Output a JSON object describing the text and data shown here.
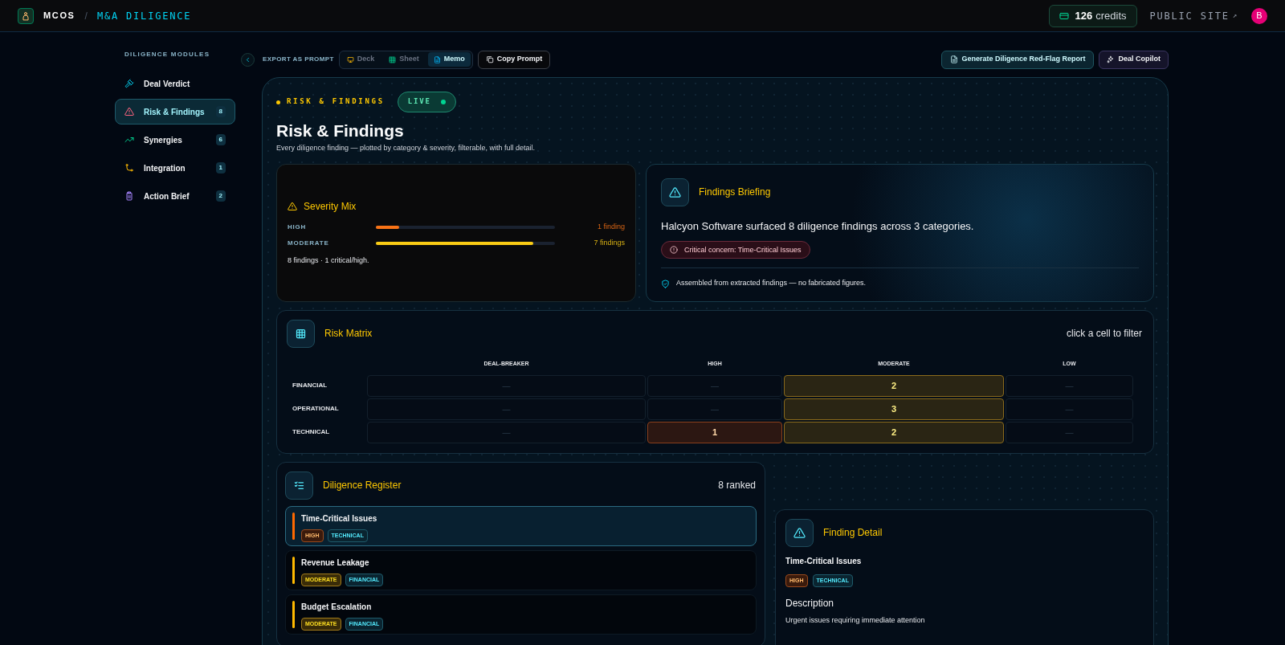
{
  "app": {
    "brand": "MCOS",
    "separator": "/",
    "section": "M&A DILIGENCE",
    "credits_count": "126",
    "credits_label": "credits",
    "public_site": "PUBLIC SITE",
    "public_site_arrow": "↗",
    "avatar": "B"
  },
  "sidebar": {
    "title": "DILIGENCE MODULES",
    "items": [
      {
        "label": "Deal Verdict",
        "selected": false
      },
      {
        "label": "Risk & Findings",
        "count": "8",
        "selected": true
      },
      {
        "label": "Synergies",
        "count": "6",
        "selected": false
      },
      {
        "label": "Integration",
        "count": "1",
        "selected": false
      },
      {
        "label": "Action Brief",
        "count": "2",
        "selected": false
      }
    ]
  },
  "toolbar": {
    "export_label": "EXPORT AS PROMPT",
    "formats": [
      {
        "label": "Deck",
        "selected": false
      },
      {
        "label": "Sheet",
        "selected": false
      },
      {
        "label": "Memo",
        "selected": true
      }
    ],
    "copy_button": "Copy Prompt",
    "report_button": "Generate Diligence Red-Flag Report",
    "copilot_button": "Deal Copilot"
  },
  "header": {
    "eyebrow": "RISK & FINDINGS",
    "live": "LIVE",
    "title": "Risk & Findings",
    "subtitle": "Every diligence finding — plotted by category & severity, filterable, with full detail."
  },
  "severity_mix": {
    "title": "Severity Mix",
    "rows": [
      {
        "label": "HIGH",
        "level": 0.13,
        "reading": "1 finding",
        "color": "#f97316"
      },
      {
        "label": "MODERATE",
        "level": 0.88,
        "reading": "7 findings",
        "color": "#facc15"
      }
    ],
    "summary": "8 findings · 1 critical/high."
  },
  "briefing": {
    "title": "Findings Briefing",
    "text": "Halcyon Software surfaced 8 diligence findings across 3 categories.",
    "alert": "Critical concern: Time-Critical Issues",
    "footnote": "Assembled from extracted findings — no fabricated figures."
  },
  "risk_matrix": {
    "title": "Risk Matrix",
    "hint": "click a cell to filter",
    "columns": [
      {
        "label": "DEAL-BREAKER",
        "kind": "critical"
      },
      {
        "label": "HIGH",
        "kind": "high"
      },
      {
        "label": "MODERATE",
        "kind": "moderate"
      },
      {
        "label": "LOW",
        "kind": "low"
      }
    ],
    "rows": [
      {
        "label": "FINANCIAL",
        "cells": [
          {
            "value": "—",
            "filled": false
          },
          {
            "value": "—",
            "filled": false
          },
          {
            "value": "2",
            "filled": true
          },
          {
            "value": "—",
            "filled": false
          }
        ]
      },
      {
        "label": "OPERATIONAL",
        "cells": [
          {
            "value": "—",
            "filled": false
          },
          {
            "value": "—",
            "filled": false
          },
          {
            "value": "3",
            "filled": true
          },
          {
            "value": "—",
            "filled": false
          }
        ]
      },
      {
        "label": "TECHNICAL",
        "cells": [
          {
            "value": "—",
            "filled": false
          },
          {
            "value": "1",
            "filled": true
          },
          {
            "value": "2",
            "filled": true
          },
          {
            "value": "—",
            "filled": false
          }
        ]
      }
    ]
  },
  "register": {
    "title": "Diligence Register",
    "count": "8 ranked",
    "items": [
      {
        "title": "Time-Critical Issues",
        "selected": true,
        "tags": [
          {
            "label": "HIGH",
            "kind": "high"
          },
          {
            "label": "TECHNICAL",
            "kind": "category"
          }
        ]
      },
      {
        "title": "Revenue Leakage",
        "selected": false,
        "tags": [
          {
            "label": "MODERATE",
            "kind": "moderate"
          },
          {
            "label": "FINANCIAL",
            "kind": "category"
          }
        ]
      },
      {
        "title": "Budget Escalation",
        "selected": false,
        "tags": [
          {
            "label": "MODERATE",
            "kind": "moderate"
          },
          {
            "label": "FINANCIAL",
            "kind": "category"
          }
        ]
      }
    ]
  },
  "detail": {
    "title": "Finding Detail",
    "finding_title": "Time-Critical Issues",
    "tags": [
      {
        "label": "HIGH",
        "kind": "high"
      },
      {
        "label": "TECHNICAL",
        "kind": "category"
      }
    ],
    "section_heading": "Description",
    "description": "Urgent issues requiring immediate attention"
  }
}
